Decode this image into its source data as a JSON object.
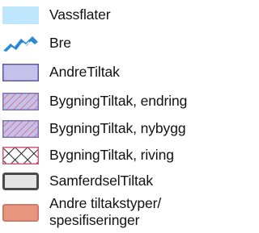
{
  "legend": {
    "items": [
      {
        "label": "Vassflater",
        "symbol": "vassflater-swatch",
        "fill": "#bfe6ff"
      },
      {
        "label": "Bre",
        "symbol": "bre-glacier-icon",
        "color": "#2a88d8"
      },
      {
        "label": "AndreTiltak",
        "symbol": "andretiltak-swatch",
        "fill": "#c4c2ea",
        "stroke": "#5b5aa8"
      },
      {
        "label": "BygningTiltak, endring",
        "symbol": "bygningtiltak-endring-hatch",
        "fill": "#c4c2ea",
        "hatch": "#e0748c"
      },
      {
        "label": "BygningTiltak, nybygg",
        "symbol": "bygningtiltak-nybygg-hatch",
        "fill": "#c4c2ea",
        "hatch": "#e0748c"
      },
      {
        "label": "BygningTiltak, riving",
        "symbol": "bygningtiltak-riving-crosshatch",
        "fill": "#ffffff",
        "hatch": "#111111"
      },
      {
        "label": "SamferdselTiltak",
        "symbol": "samferdseltiltak-swatch",
        "fill": "#e4e4e4",
        "stroke": "#4a4a4a"
      },
      {
        "label_line1": "Andre tiltakstyper/",
        "label_line2": "spesifiseringer",
        "symbol": "andre-tiltakstyper-swatch",
        "fill": "#e8967e",
        "stroke": "#d07a6e"
      }
    ]
  }
}
